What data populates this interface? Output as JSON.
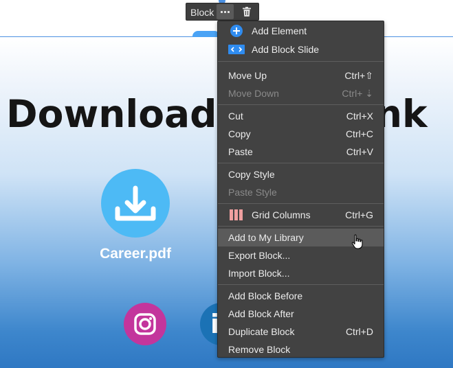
{
  "page": {
    "headline_left": "Download &",
    "headline_right": "ink",
    "file_label": "Career.pdf"
  },
  "toolbar": {
    "label": "Block"
  },
  "context_menu": {
    "groups": [
      [
        {
          "label": "Add Element",
          "icon": "plus-circle-icon",
          "shortcut": ""
        },
        {
          "label": "Add Block Slide",
          "icon": "slide-arrows-icon",
          "shortcut": ""
        }
      ],
      [
        {
          "label": "Move Up",
          "shortcut": "Ctrl+⇧"
        },
        {
          "label": "Move Down",
          "shortcut": "Ctrl+ ⇣",
          "disabled": true
        }
      ],
      [
        {
          "label": "Cut",
          "shortcut": "Ctrl+X"
        },
        {
          "label": "Copy",
          "shortcut": "Ctrl+C"
        },
        {
          "label": "Paste",
          "shortcut": "Ctrl+V"
        }
      ],
      [
        {
          "label": "Copy Style",
          "shortcut": ""
        },
        {
          "label": "Paste Style",
          "shortcut": "",
          "disabled": true
        }
      ],
      [
        {
          "label": "Grid Columns",
          "icon": "grid-columns-icon",
          "shortcut": "Ctrl+G"
        }
      ],
      [
        {
          "label": "Add to My Library",
          "shortcut": "",
          "highlighted": true
        },
        {
          "label": "Export Block...",
          "shortcut": ""
        },
        {
          "label": "Import Block...",
          "shortcut": ""
        }
      ],
      [
        {
          "label": "Add Block Before",
          "shortcut": ""
        },
        {
          "label": "Add Block After",
          "shortcut": ""
        },
        {
          "label": "Duplicate Block",
          "shortcut": "Ctrl+D"
        },
        {
          "label": "Remove Block",
          "shortcut": ""
        }
      ]
    ]
  },
  "colors": {
    "menu_bg": "#424242",
    "accent_blue": "#4a90e2",
    "download_circle": "#4dbaf5",
    "instagram": "#c3359c",
    "linkedin": "#1b72b5",
    "grid_icon": "#f0a0a0"
  }
}
